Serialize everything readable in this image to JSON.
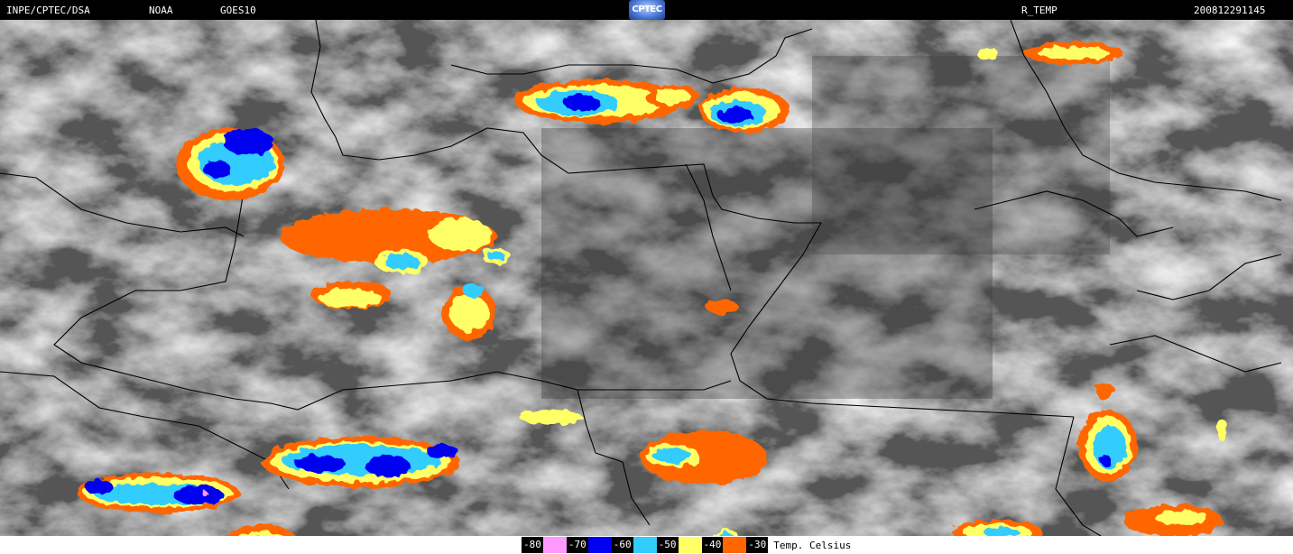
{
  "header": {
    "source": "INPE/CPTEC/DSA",
    "agency": "NOAA",
    "satellite": "GOES10",
    "logo_text": "CPTEC",
    "product": "R_TEMP",
    "timestamp": "200812291145"
  },
  "legend": {
    "items": [
      {
        "value": "-80",
        "color": "#ff99ff"
      },
      {
        "value": "-70",
        "color": "#0000f0"
      },
      {
        "value": "-60",
        "color": "#33ccff"
      },
      {
        "value": "-50",
        "color": "#ffff66"
      },
      {
        "value": "-40",
        "color": "#ff6600"
      },
      {
        "value": "-30",
        "color": "#000000"
      }
    ],
    "unit": "Temp. Celsius"
  },
  "colors": {
    "background_cloud": "#5a5a5a",
    "border_lines": "#000000"
  }
}
